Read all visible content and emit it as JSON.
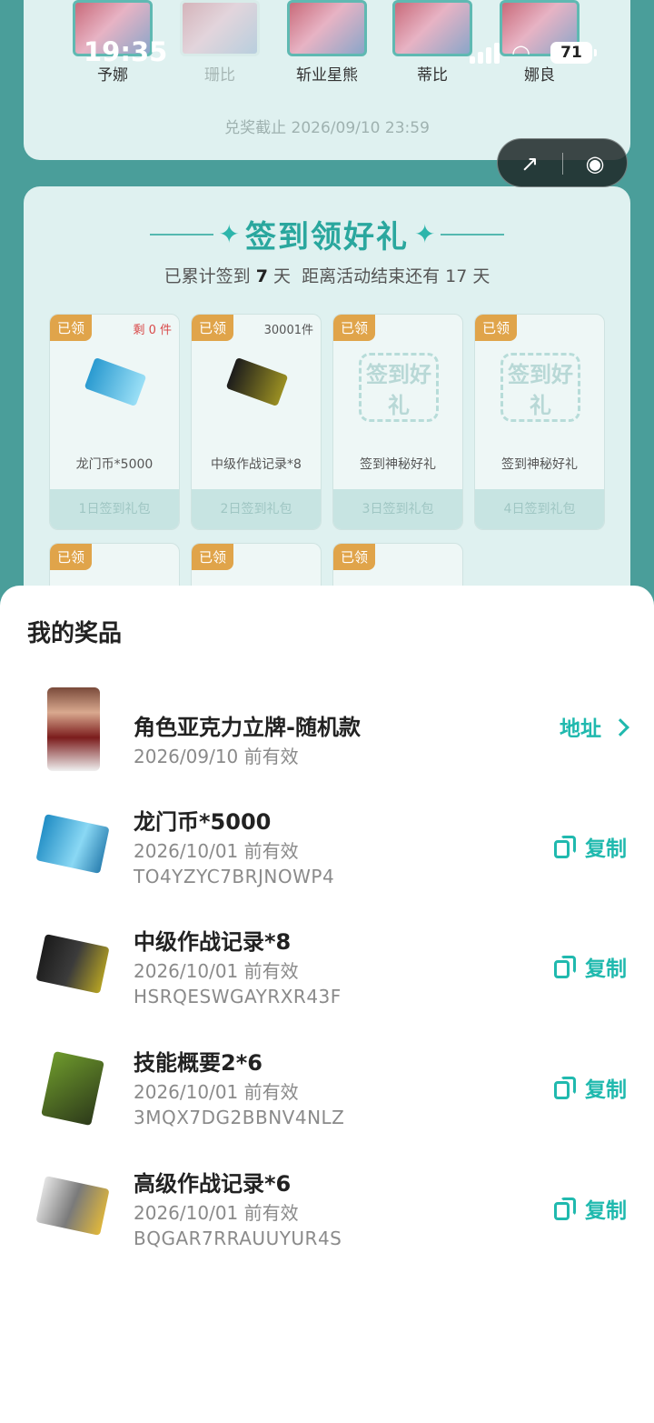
{
  "status_bar": {
    "time": "19:35",
    "battery": "71"
  },
  "background": {
    "characters": [
      {
        "name": "予娜"
      },
      {
        "name": "珊比"
      },
      {
        "name": "斩业星熊"
      },
      {
        "name": "蒂比"
      },
      {
        "name": "娜良"
      }
    ],
    "deadline": "兑奖截止 2026/09/10 23:59",
    "sign_in": {
      "title": "签到领好礼",
      "days_prefix": "已累计签到",
      "days_count": "7",
      "days_suffix": "天",
      "remaining": "距离活动结束还有 17 天",
      "gifts": [
        {
          "tag": "已领",
          "count": "剩 0 件",
          "name": "龙门币*5000",
          "day": "1日签到礼包"
        },
        {
          "tag": "已领",
          "count": "30001件",
          "name": "中级作战记录*8",
          "day": "2日签到礼包"
        },
        {
          "tag": "已领",
          "count": "",
          "name": "签到神秘好礼",
          "day": "3日签到礼包",
          "mystery": "签到好礼"
        },
        {
          "tag": "已领",
          "count": "",
          "name": "签到神秘好礼",
          "day": "4日签到礼包",
          "mystery": "签到好礼"
        }
      ],
      "row2_tags": [
        "已领",
        "已领",
        "已领"
      ]
    }
  },
  "sheet": {
    "title": "我的奖品",
    "prizes": [
      {
        "name": "角色亚克力立牌-随机款",
        "date": "2026/09/10 前有效",
        "code": "",
        "action": "地址",
        "icon": "standee-image"
      },
      {
        "name": "龙门币*5000",
        "date": "2026/10/01 前有效",
        "code": "TO4YZYC7BRJNOWP4",
        "action": "复制",
        "icon": "lmd-image"
      },
      {
        "name": "中级作战记录*8",
        "date": "2026/10/01 前有效",
        "code": "HSRQESWGAYRXR43F",
        "action": "复制",
        "icon": "record-image"
      },
      {
        "name": "技能概要2*6",
        "date": "2026/10/01 前有效",
        "code": "3MQX7DG2BBNV4NLZ",
        "action": "复制",
        "icon": "skill-image"
      },
      {
        "name": "高级作战记录*6",
        "date": "2026/10/01 前有效",
        "code": "BQGAR7RRAUUYUR4S",
        "action": "复制",
        "icon": "adv-record-image"
      }
    ]
  }
}
